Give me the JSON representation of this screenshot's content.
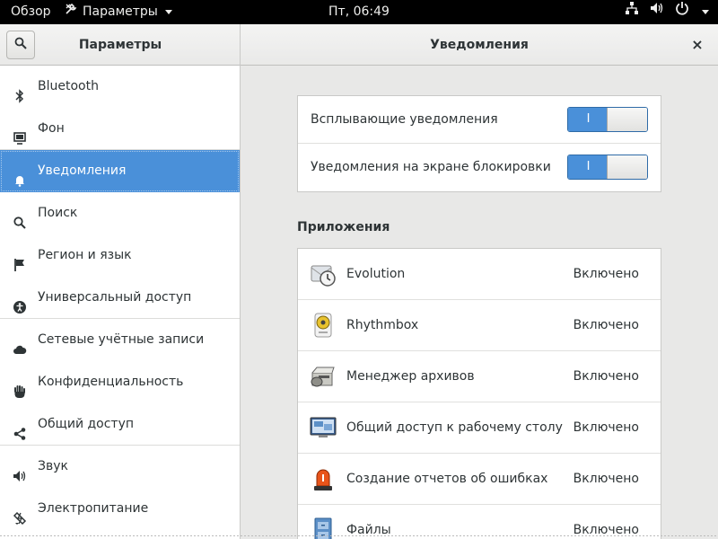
{
  "topbar": {
    "overview": "Обзор",
    "app_menu": "Параметры",
    "clock": "Пт, 06:49"
  },
  "header": {
    "left_title": "Параметры",
    "right_title": "Уведомления",
    "close": "×"
  },
  "sidebar": {
    "items": [
      {
        "label": "Bluetooth",
        "icon": "bluetooth-icon"
      },
      {
        "label": "Фон",
        "icon": "background-icon"
      },
      {
        "label": "Уведомления",
        "icon": "bell-icon",
        "active": true
      },
      {
        "label": "Поиск",
        "icon": "search-icon"
      },
      {
        "label": "Регион и язык",
        "icon": "flag-icon"
      },
      {
        "label": "Универсальный доступ",
        "icon": "accessibility-icon"
      },
      {
        "label": "Сетевые учётные записи",
        "icon": "cloud-icon"
      },
      {
        "label": "Конфиденциальность",
        "icon": "hand-icon"
      },
      {
        "label": "Общий доступ",
        "icon": "share-icon"
      },
      {
        "label": "Звук",
        "icon": "speaker-icon"
      },
      {
        "label": "Электропитание",
        "icon": "battery-icon"
      }
    ]
  },
  "notifications": {
    "popup_label": "Всплывающие уведомления",
    "popup_switch": "I",
    "lock_label": "Уведомления на экране блокировки",
    "lock_switch": "I"
  },
  "apps": {
    "title": "Приложения",
    "items": [
      {
        "name": "Evolution",
        "state": "Включено",
        "icon": "evolution-icon"
      },
      {
        "name": "Rhythmbox",
        "state": "Включено",
        "icon": "rhythmbox-icon"
      },
      {
        "name": "Менеджер архивов",
        "state": "Включено",
        "icon": "archive-manager-icon"
      },
      {
        "name": "Общий доступ к рабочему столу",
        "state": "Включено",
        "icon": "desktop-sharing-icon"
      },
      {
        "name": "Создание отчетов об ошибках",
        "state": "Включено",
        "icon": "error-report-icon"
      },
      {
        "name": "Файлы",
        "state": "Включено",
        "icon": "files-icon"
      }
    ]
  },
  "colors": {
    "accent": "#4a90d9",
    "topbar": "#000000"
  }
}
